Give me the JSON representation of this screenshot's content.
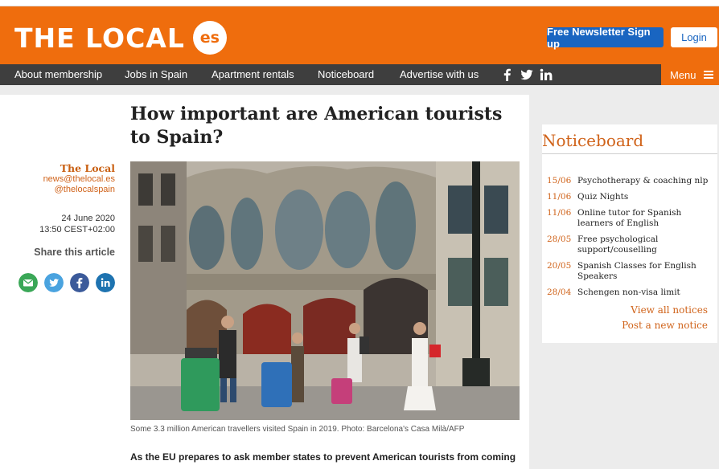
{
  "header": {
    "logo_text": "THE LOCAL",
    "logo_badge": "es",
    "newsletter_button": "Free Newsletter Sign up",
    "login_button": "Login"
  },
  "nav": {
    "items": [
      "About membership",
      "Jobs in Spain",
      "Apartment rentals",
      "Noticeboard",
      "Advertise with us"
    ],
    "social_icons": [
      "facebook-icon",
      "twitter-icon",
      "linkedin-icon"
    ],
    "menu_label": "Menu"
  },
  "article": {
    "headline": "How important are American tourists to Spain?",
    "author": "The Local",
    "email": "news@thelocal.es",
    "handle": "@thelocalspain",
    "date": "24 June 2020",
    "time": "13:50 CEST+02:00",
    "share_label": "Share this article",
    "share_icons": [
      "email-icon",
      "twitter-icon",
      "facebook-icon",
      "linkedin-icon"
    ],
    "photo_caption": "Some 3.3 million American travellers visited Spain in 2019. Photo: Barcelona's Casa Milà/AFP",
    "intro_text": "As the EU prepares to ask member states to prevent American tourists from coming"
  },
  "noticeboard": {
    "title": "Noticeboard",
    "items": [
      {
        "date": "15/06",
        "text": "Psychotherapy & coaching nlp"
      },
      {
        "date": "11/06",
        "text": "Quiz Nights"
      },
      {
        "date": "11/06",
        "text": "Online tutor for Spanish learners of English"
      },
      {
        "date": "28/05",
        "text": "Free psychological support/couselling"
      },
      {
        "date": "20/05",
        "text": "Spanish Classes for English Speakers"
      },
      {
        "date": "28/04",
        "text": "Schengen non-visa limit"
      }
    ],
    "view_all": "View all notices",
    "post_new": "Post a new notice"
  },
  "colors": {
    "brand_orange": "#ef6d0d",
    "nav_dark": "#3e3e3e",
    "newsletter_blue": "#1965c1",
    "link_orange": "#d0631a"
  }
}
